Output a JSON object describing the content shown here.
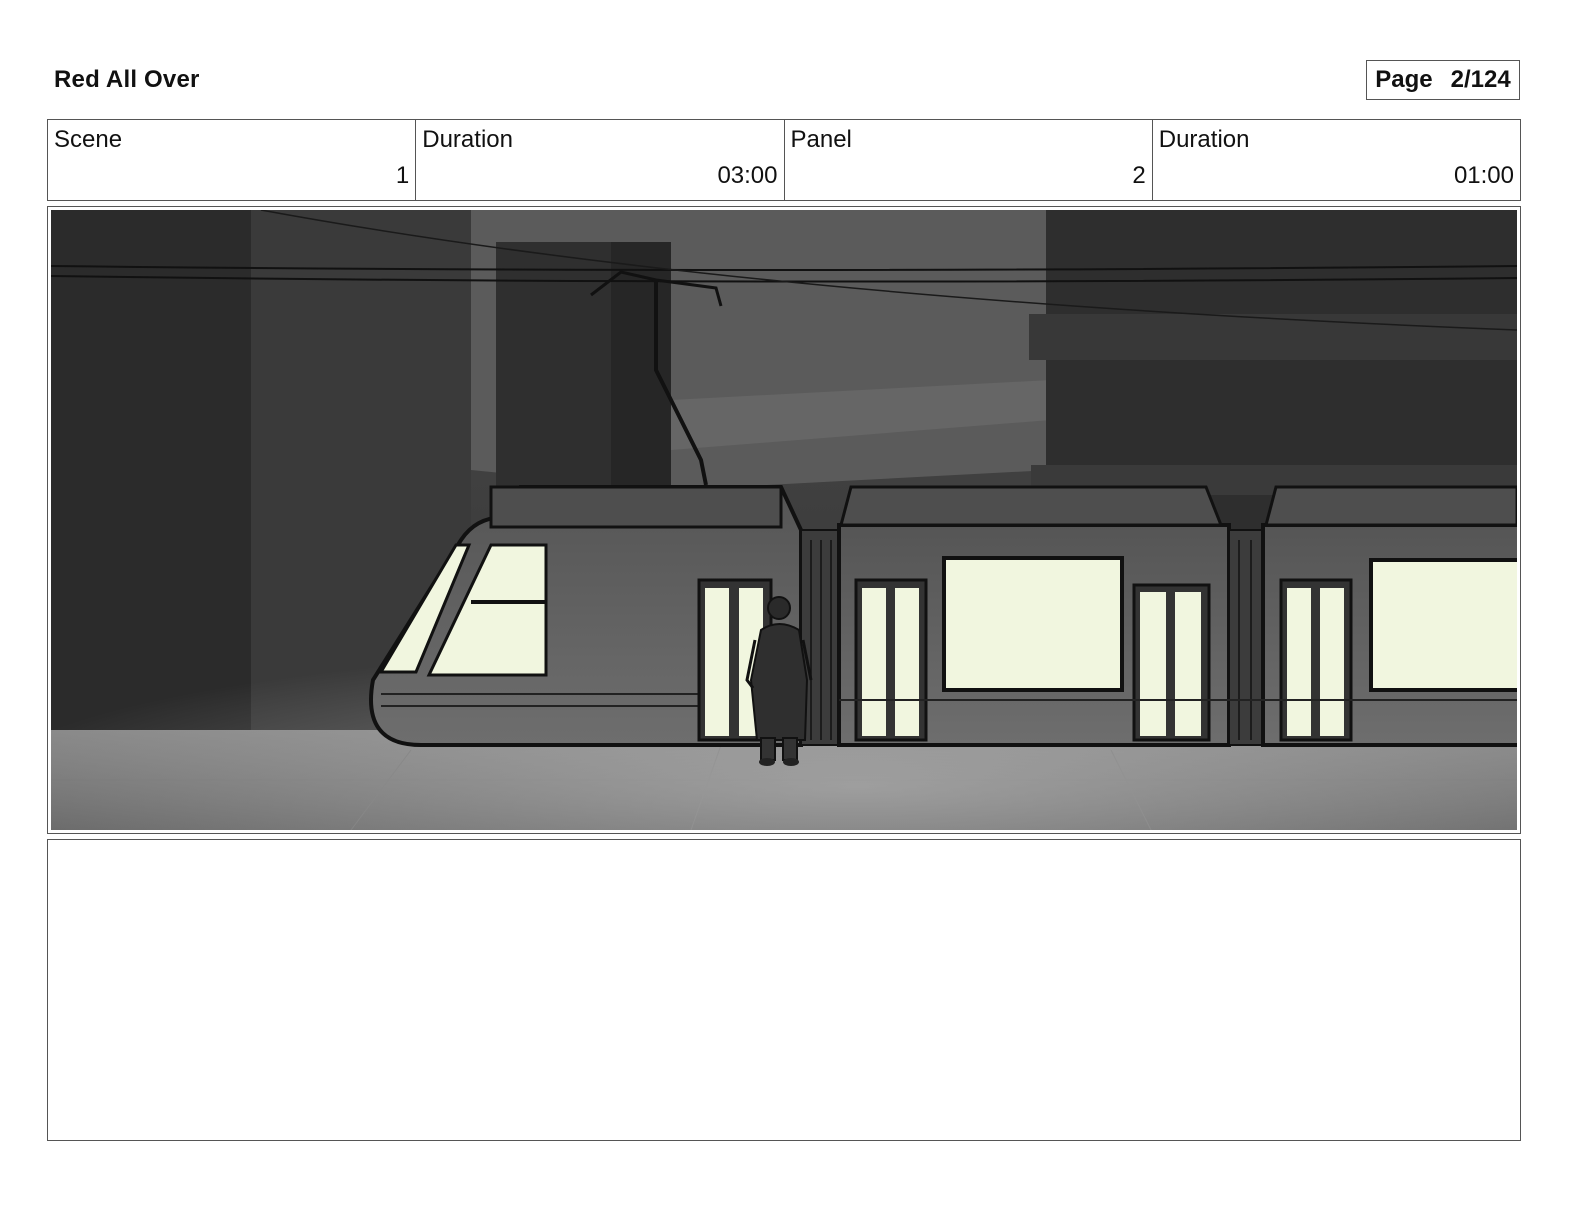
{
  "header": {
    "title": "Red All Over",
    "page_label": "Page",
    "page_value": "2/124"
  },
  "info": {
    "scene_label": "Scene",
    "scene_value": "1",
    "scene_duration_label": "Duration",
    "scene_duration_value": "03:00",
    "panel_label": "Panel",
    "panel_value": "2",
    "panel_duration_label": "Duration",
    "panel_duration_value": "01:00"
  },
  "colors": {
    "frame_border": "#555555",
    "window_glow": "#f1f6df",
    "tram_body": "#5a5a5a"
  }
}
